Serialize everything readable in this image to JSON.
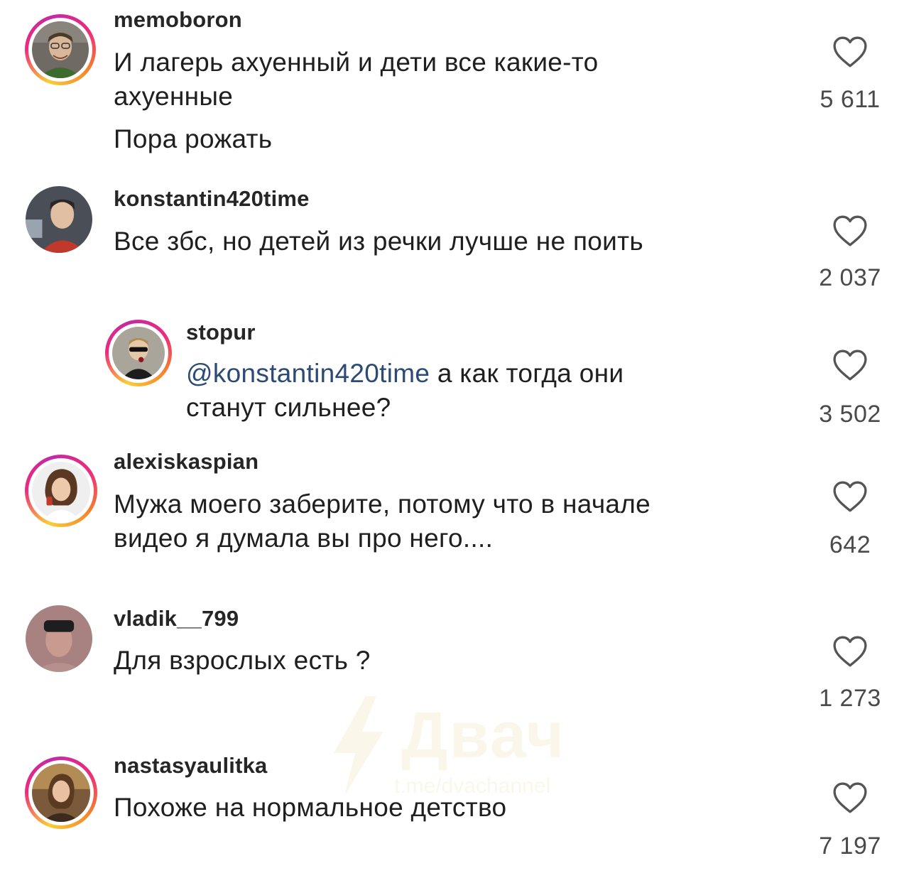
{
  "comments": [
    {
      "username": "memoboron",
      "text_lines": [
        "И лагерь ахуенный и дети все какие-то",
        "ахуенные"
      ],
      "extra_line": "Пора рожать",
      "likes": "5 611",
      "story_ring": true
    },
    {
      "username": "konstantin420time",
      "text_lines": [
        "Все збс, но детей из речки лучше не поить"
      ],
      "likes": "2 037",
      "story_ring": false
    },
    {
      "username": "stopur",
      "mention": "@konstantin420time",
      "text_after_mention": " а как тогда они",
      "text_line2": "станут сильнее?",
      "likes": "3 502",
      "story_ring": true,
      "is_reply": true
    },
    {
      "username": "alexiskaspian",
      "text_lines": [
        "Мужа моего заберите, потому что в начале",
        "видео я думала вы про него...."
      ],
      "likes": "642",
      "story_ring": true
    },
    {
      "username": "vladik__799",
      "text_lines": [
        "Для взрослых есть ?"
      ],
      "likes": "1 273",
      "story_ring": false
    },
    {
      "username": "nastasyaulitka",
      "text_lines": [
        "Похоже на нормальное детство"
      ],
      "likes": "7 197",
      "story_ring": true
    }
  ],
  "watermark": {
    "title": "Двач",
    "subtitle": "t.me/dvachannel"
  },
  "icons": {
    "like": "heart-icon",
    "avatar": "user-avatar"
  },
  "colors": {
    "mention": "#2b4a75",
    "story_ring_start": "#f9ce34",
    "story_ring_mid": "#ee2a7b",
    "story_ring_end": "#c32aa3"
  }
}
